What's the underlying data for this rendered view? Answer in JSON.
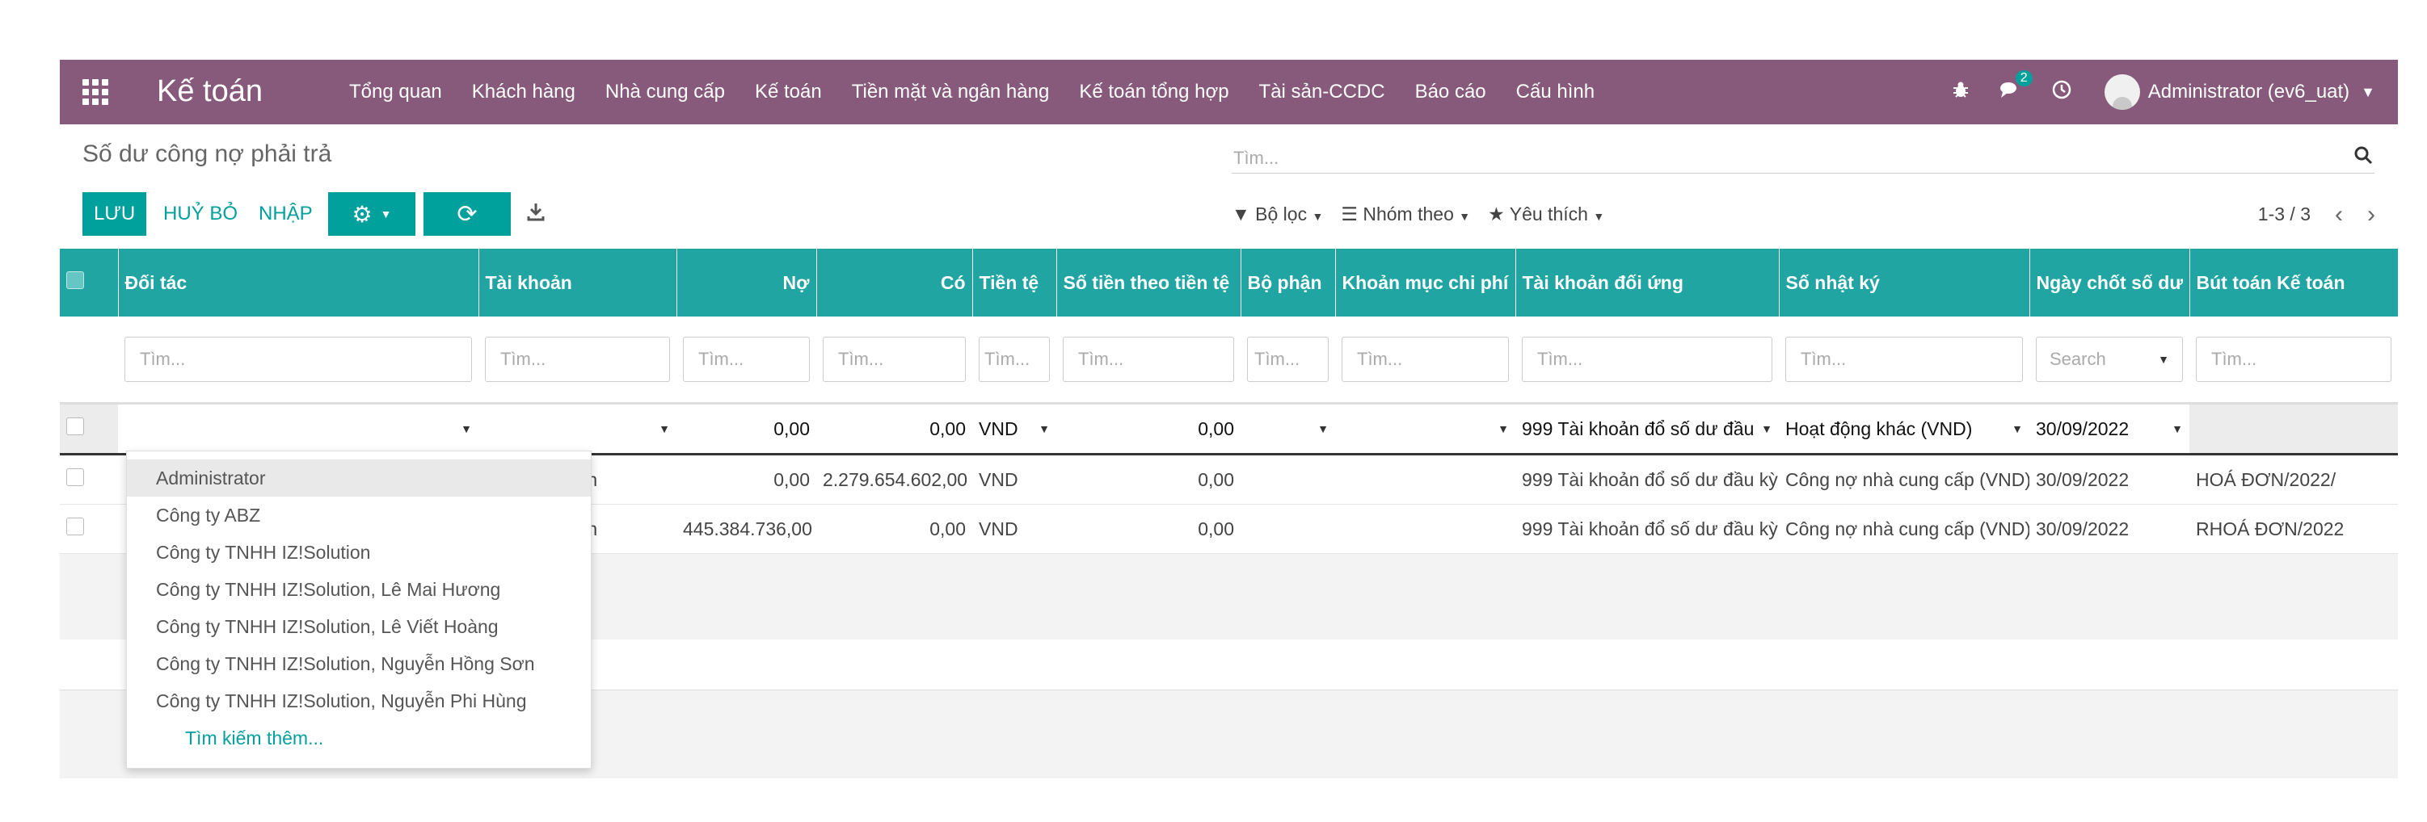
{
  "navbar": {
    "app_title": "Kế toán",
    "menu": [
      "Tổng quan",
      "Khách hàng",
      "Nhà cung cấp",
      "Kế toán",
      "Tiền mặt và ngân hàng",
      "Kế toán tổng hợp",
      "Tài sản-CCDC",
      "Báo cáo",
      "Cấu hình"
    ],
    "chat_count": "2",
    "user": "Administrator (ev6_uat)",
    "icons": [
      "apps-icon",
      "bug-icon",
      "chat-icon",
      "clock-icon",
      "user-avatar",
      "chevron-down-icon"
    ]
  },
  "control_panel": {
    "breadcrumb": "Số dư công nợ phải trả",
    "save_label": "LƯU",
    "discard_label": "HUỶ BỎ",
    "import_label": "NHẬP",
    "search_placeholder": "Tìm...",
    "filter_label": "Bộ lọc",
    "groupby_label": "Nhóm theo",
    "favorites_label": "Yêu thích",
    "pager": "1-3 / 3"
  },
  "table": {
    "columns": [
      "Đối tác",
      "Tài khoản",
      "Nợ",
      "Có",
      "Tiền tệ",
      "Số tiền theo tiền tệ",
      "Bộ phận",
      "Khoản mục chi phí",
      "Tài khoản đối ứng",
      "Số nhật ký",
      "Ngày chốt số dư",
      "Bút toán Kế toán"
    ],
    "filter_placeholders": [
      "Tìm...",
      "Tìm...",
      "Tìm...",
      "Tìm...",
      "Tìm...",
      "Tìm...",
      "Tìm...",
      "Tìm...",
      "Tìm...",
      "Tìm...",
      "Search",
      "Tìm..."
    ],
    "edit_row": {
      "debit": "0,00",
      "credit": "0,00",
      "currency": "VND",
      "amount_currency": "0,00",
      "counterpart_account": "999 Tài khoản đổ số dư đầu",
      "journal": "Hoạt động khác (VND)",
      "date": "30/09/2022"
    },
    "rows": [
      {
        "partner": "",
        "account": "trả người bán",
        "debit": "0,00",
        "credit": "2.279.654.602,00",
        "currency": "VND",
        "amount_currency": "0,00",
        "department": "",
        "expense_item": "",
        "counterpart_account": "999 Tài khoản đổ số dư đầu kỳ",
        "journal": "Công nợ nhà cung cấp (VND)",
        "date": "30/09/2022",
        "move": "HOÁ ĐƠN/2022/"
      },
      {
        "partner": "",
        "account": "trả người bán",
        "debit": "445.384.736,00",
        "credit": "0,00",
        "currency": "VND",
        "amount_currency": "0,00",
        "department": "",
        "expense_item": "",
        "counterpart_account": "999 Tài khoản đổ số dư đầu kỳ",
        "journal": "Công nợ nhà cung cấp (VND)",
        "date": "30/09/2022",
        "move": "RHOÁ ĐƠN/2022"
      }
    ]
  },
  "dropdown": {
    "items": [
      "Administrator",
      "Công ty ABZ",
      "Công ty TNHH IZ!Solution",
      "Công ty TNHH IZ!Solution, Lê Mai Hương",
      "Công ty TNHH IZ!Solution, Lê Viết Hoàng",
      "Công ty TNHH IZ!Solution, Nguyễn Hồng Sơn",
      "Công ty TNHH IZ!Solution, Nguyễn Phi Hùng"
    ],
    "more": "Tìm kiếm thêm..."
  },
  "colors": {
    "navbar": "#875a7b",
    "accent": "#00a09d",
    "header": "#20a5a3"
  }
}
